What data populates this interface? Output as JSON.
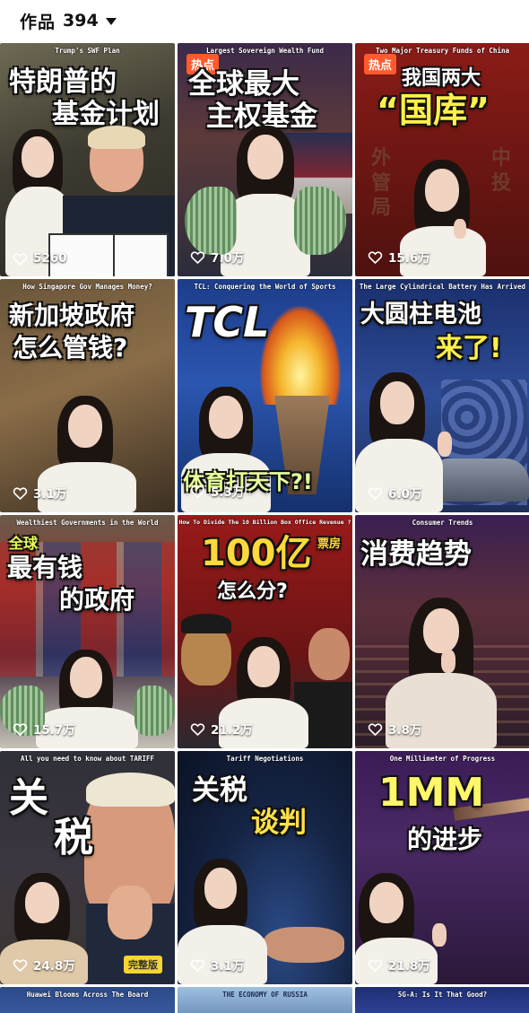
{
  "header": {
    "title": "作品",
    "count": "394",
    "dropdown_icon": "caret-down-icon"
  },
  "colors": {
    "like_text": "#ffffff",
    "hot_badge": "#ff5a2d",
    "complete_badge": "#f6d533",
    "title_yellow": "#fff04a"
  },
  "videos": [
    {
      "subtitle": "Trump's SWF Plan",
      "title_lines": [
        "特朗普的",
        "基金计划"
      ],
      "likes": "5260",
      "hot": "",
      "badge": ""
    },
    {
      "subtitle": "Largest Sovereign Wealth Fund",
      "title_lines": [
        "全球最大",
        "主权基金"
      ],
      "likes": "7.0万",
      "hot": "热点",
      "badge": ""
    },
    {
      "subtitle": "Two Major Treasury Funds of China",
      "title_lines": [
        "我国两大",
        "“国库”"
      ],
      "likes": "15.6万",
      "hot": "热点",
      "badge": ""
    },
    {
      "subtitle": "How Singapore Gov Manages Money?",
      "title_lines": [
        "新加坡政府",
        "怎么管钱?"
      ],
      "likes": "3.1万",
      "hot": "",
      "badge": ""
    },
    {
      "subtitle": "TCL: Conquering the World of Sports",
      "title_lines": [
        "TCL",
        "体育打天下?!"
      ],
      "likes": "5.3万",
      "hot": "",
      "badge": ""
    },
    {
      "subtitle": "The Large Cylindrical Battery Has Arrived",
      "title_lines": [
        "大圆柱电池",
        "来了!"
      ],
      "likes": "6.0万",
      "hot": "",
      "badge": ""
    },
    {
      "subtitle": "Wealthiest Governments in the World",
      "title_lines": [
        "全球",
        "最有钱",
        "的政府"
      ],
      "likes": "15.7万",
      "hot": "",
      "badge": ""
    },
    {
      "subtitle": "How To Divide The 10 Billion Box Office Revenue ?",
      "title_lines": [
        "100亿",
        "票房",
        "怎么分?"
      ],
      "likes": "21.2万",
      "hot": "",
      "badge": ""
    },
    {
      "subtitle": "Consumer Trends",
      "title_lines": [
        "消费趋势"
      ],
      "likes": "3.8万",
      "hot": "",
      "badge": ""
    },
    {
      "subtitle": "All you need to know about TARIFF",
      "title_lines": [
        "关",
        "税"
      ],
      "likes": "24.8万",
      "hot": "",
      "badge": "完整版"
    },
    {
      "subtitle": "Tariff Negotiations",
      "title_lines": [
        "关税",
        "谈判"
      ],
      "likes": "3.1万",
      "hot": "",
      "badge": ""
    },
    {
      "subtitle": "One Millimeter of Progress",
      "title_lines": [
        "1MM",
        "的进步"
      ],
      "likes": "21.8万",
      "hot": "",
      "badge": ""
    },
    {
      "subtitle": "Huawei Blooms Across The Board",
      "title_lines": [],
      "likes": "",
      "hot": "",
      "badge": ""
    },
    {
      "subtitle": "THE ECONOMY OF RUSSIA",
      "title_lines": [],
      "likes": "",
      "hot": "",
      "badge": ""
    },
    {
      "subtitle": "5G-A: Is It That Good?",
      "title_lines": [],
      "likes": "",
      "hot": "",
      "badge": ""
    }
  ]
}
